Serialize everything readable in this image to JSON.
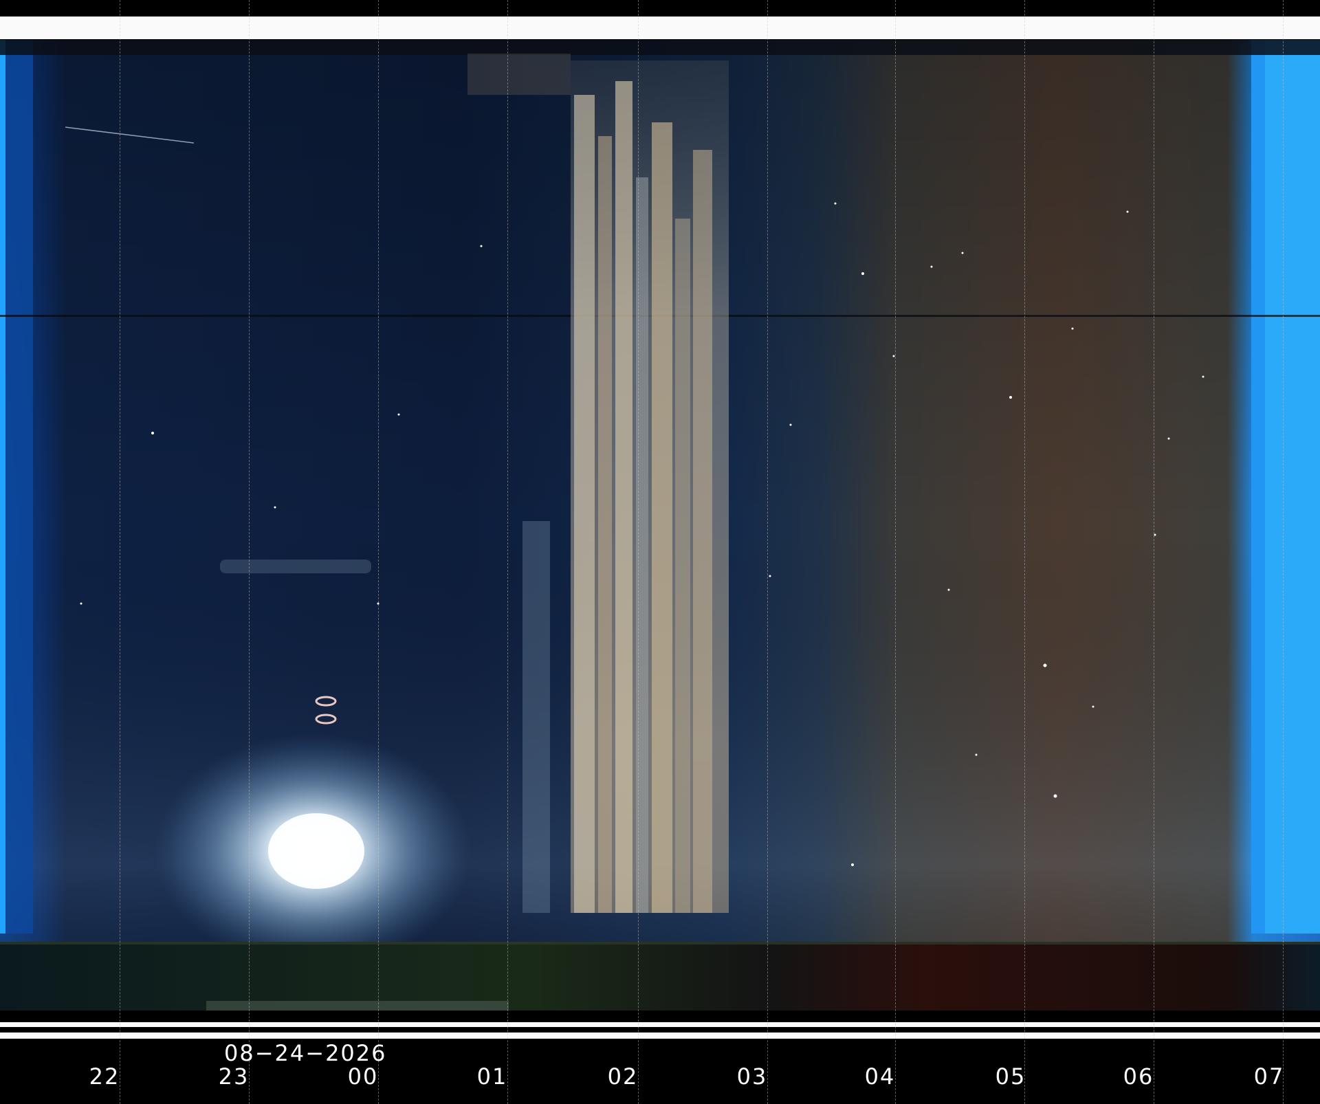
{
  "date": "08−24−2026",
  "hours": [
    "22",
    "23",
    "00",
    "01",
    "02",
    "03",
    "04",
    "05",
    "06",
    "07"
  ],
  "colors": {
    "background": "#000000",
    "band": "#fafafa",
    "night_sky": "#0b1a33",
    "twilight": "#1e88e5",
    "cloud": "#d8c2a0",
    "moon_glow": "#e8f6ff",
    "late_night": "#4a3a30"
  }
}
